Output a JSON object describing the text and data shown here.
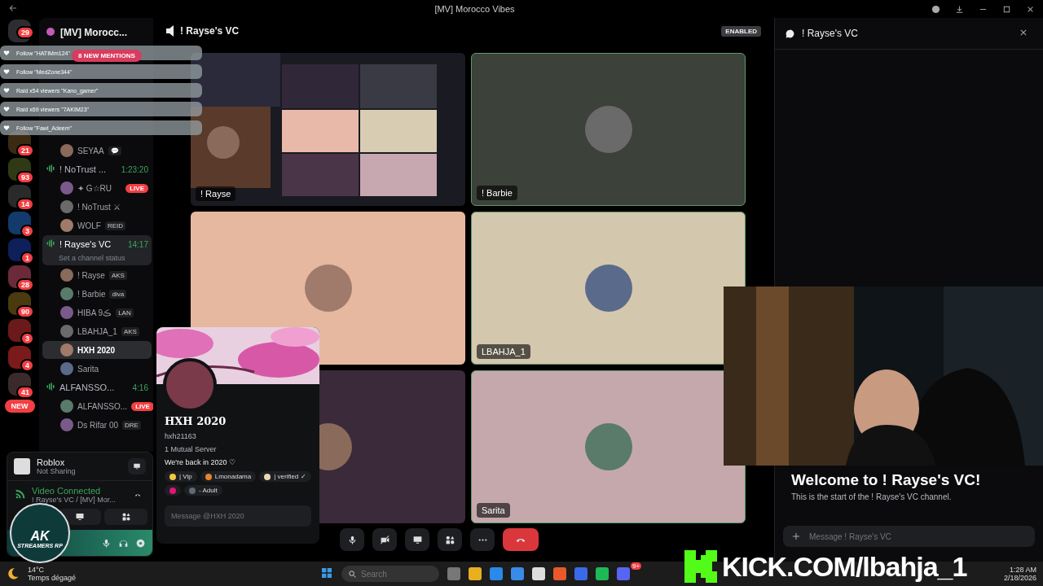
{
  "window": {
    "title": "[MV] Morocco Vibes"
  },
  "servers": [
    {
      "badge": "29",
      "color": "#2b2d31"
    },
    {
      "badge": "21",
      "color": "#3b2a12"
    },
    {
      "badge": "93",
      "color": "#2f3a14"
    },
    {
      "badge": "14",
      "color": "#2a2a2a"
    },
    {
      "badge": "3",
      "color": "#123a6a"
    },
    {
      "badge": "1",
      "color": "#0e1f5a"
    },
    {
      "badge": "28",
      "color": "#6a2a3a"
    },
    {
      "badge": "90",
      "color": "#4a3a10"
    },
    {
      "badge": "3",
      "color": "#6a1a1a"
    },
    {
      "badge": "4",
      "color": "#7a1a1a"
    },
    {
      "badge": "41",
      "color": "#3a2a2a"
    }
  ],
  "new_pill": "NEW",
  "notifications": [
    "Follow \"HATIMm124\"",
    "Follow \"MedZone344\"",
    "Raid x54 viewers \"Kano_gamer\"",
    "Raid x69 viewers \"7AKIM23\"",
    "Follow \"Fawl_Adeem\""
  ],
  "mentions_badge": "8 NEW MENTIONS",
  "server_header": {
    "name": "[MV] Morocc..."
  },
  "channel_list": [
    {
      "kind": "member",
      "name": "SEYAA",
      "tag": "💬",
      "selected": false
    },
    {
      "kind": "voice",
      "name": "! NoTrust ...",
      "time": "1:23:20",
      "selected": false
    },
    {
      "kind": "member",
      "name": "✦ G☆RU",
      "live_badge": "LIVE",
      "selected": false
    },
    {
      "kind": "member",
      "name": "! NoTrust ⚔",
      "selected": false
    },
    {
      "kind": "member",
      "name": "WOLF",
      "tag": "REID",
      "selected": false
    },
    {
      "kind": "voice",
      "name": "! Rayse's VC",
      "time": "14:17",
      "status": "Set a channel status",
      "selected": true
    },
    {
      "kind": "member",
      "name": "! Rayse",
      "tag": "AKS",
      "selected": false
    },
    {
      "kind": "member",
      "name": "! Barbie",
      "tag": "diva",
      "selected": false
    },
    {
      "kind": "member",
      "name": "HIBA 9ڪ",
      "tag": "LAN",
      "selected": false
    },
    {
      "kind": "member",
      "name": "LBAHJA_1",
      "tag": "AKS",
      "selected": false
    },
    {
      "kind": "member",
      "name": "HXH 2020",
      "selected": true
    },
    {
      "kind": "member",
      "name": "Sarita",
      "selected": false
    },
    {
      "kind": "voice",
      "name": "ALFANSSO...",
      "time": "4:16",
      "selected": false
    },
    {
      "kind": "member",
      "name": "ALFANSSO...",
      "live_badge": "LIVE",
      "selected": false
    },
    {
      "kind": "member",
      "name": "Ds Rifar 00",
      "tag": "DRE",
      "selected": false
    }
  ],
  "activity": {
    "title": "Roblox",
    "subtitle": "Not Sharing"
  },
  "connection": {
    "status": "Video Connected",
    "channel": "! Rayse's VC / [MV] Mor..."
  },
  "stream_logo": {
    "title": "AK",
    "subtitle": "STREAMERS RP"
  },
  "call_header": {
    "title": "! Rayse's VC",
    "badge": "ENABLED"
  },
  "tiles": [
    {
      "kind": "screen",
      "label": "! Rayse",
      "color": "#1a1a22"
    },
    {
      "kind": "camera",
      "label": "! Barbie",
      "color": "#3c4139"
    },
    {
      "kind": "camera",
      "color": "#e6b8a0"
    },
    {
      "kind": "camera",
      "label": "LBAHJA_1",
      "color": "#d3c7ae"
    },
    {
      "kind": "camera",
      "color": "#3b2a3a"
    },
    {
      "kind": "camera",
      "label": "Sarita",
      "color": "#c4a8ac"
    }
  ],
  "profile": {
    "name": "HXH 2020",
    "username": "hxh21163",
    "mutual": "1 Mutual Server",
    "bio": "We're back in 2020 ♡",
    "roles": [
      {
        "name": "| Vip",
        "color": "#f4c542"
      },
      {
        "name": "Lmonadama",
        "color": "#e8832a"
      },
      {
        "name": "| verified ✓",
        "color": "#ead7b8"
      },
      {
        "color": "#e0157a"
      },
      {
        "name": "- Adult",
        "color": "#5b6b78"
      }
    ],
    "message_placeholder": "Message @HXH 2020"
  },
  "chat": {
    "title": "! Rayse's VC",
    "welcome": "Welcome to ! Rayse's VC!",
    "intro": "This is the start of the ! Rayse's VC channel.",
    "placeholder": "Message ! Rayse's VC"
  },
  "kick_banner": "KICK.COM/lbahja_1",
  "taskbar": {
    "temperature": "14°C",
    "weather": "Temps dégagé",
    "search_placeholder": "Search",
    "time": "1:28 AM",
    "date": "2/18/2026",
    "discord_badge": "9+"
  }
}
